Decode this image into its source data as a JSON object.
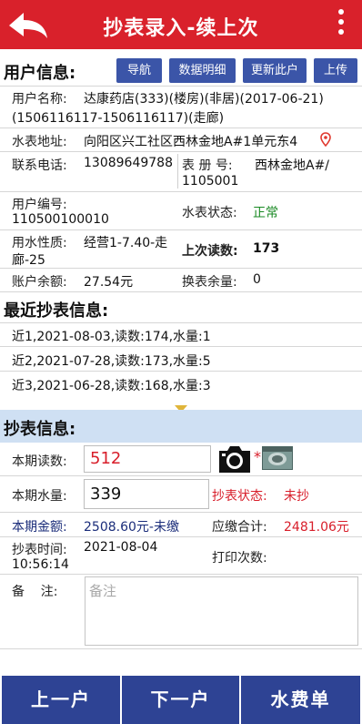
{
  "header": {
    "title": "抄表录入-续上次"
  },
  "user_section": {
    "title": "用户信息:",
    "buttons": [
      "导航",
      "数据明细",
      "更新此户",
      "上传"
    ]
  },
  "user_info": {
    "name_label": "用户名称:",
    "name_value": "达康药店(333)(楼房)(非居)(2017-06-21)",
    "name_value2": "(1506116117-1506116117)(走廊)",
    "meter_addr_label": "水表地址:",
    "meter_addr_value": "向阳区兴工社区西林金地A#1单元东4",
    "phone_label": "联系电话:",
    "phone_value": "13089649788",
    "register_label": "表  册  号:",
    "register_value": "西林金地A#/",
    "register_value2": "1105001",
    "user_no_label": "用户编号:",
    "user_no_value": "110500100010",
    "meter_status_label": "水表状态:",
    "meter_status_value": "正常",
    "water_type_label": "用水性质:",
    "water_type_value": "经营1-7.40-走",
    "water_type_value2": "廊-25",
    "last_reading_label": "上次读数:",
    "last_reading_value": "173",
    "balance_label": "账户余额:",
    "balance_value": "27.54元",
    "swap_remain_label": "换表余量:",
    "swap_remain_value": "0"
  },
  "recent_section": {
    "title": "最近抄表信息:",
    "items": [
      "近1,2021-08-03,读数:174,水量:1",
      "近2,2021-07-28,读数:173,水量:5",
      "近3,2021-06-28,读数:168,水量:3"
    ]
  },
  "reading_section": {
    "title": "抄表信息:",
    "current_reading_label": "本期读数:",
    "current_reading_value": "512",
    "current_volume_label": "本期水量:",
    "current_volume_value": "339",
    "reading_status_label": "抄表状态:",
    "reading_status_value": "未抄",
    "amount_label": "本期金额:",
    "amount_value": "2508.60元-未缴",
    "total_due_label": "应缴合计:",
    "total_due_value": "2481.06元",
    "read_time_label": "抄表时间:",
    "read_time_value": "2021-08-04",
    "read_time_value2": "10:56:14",
    "print_count_label": "打印次数:",
    "remark_label": "备    注:",
    "remark_placeholder": "备注",
    "required_mark": "*"
  },
  "bottom": {
    "prev": "上一户",
    "next": "下一户",
    "bill": "水费单"
  },
  "colors": {
    "header_red": "#d9212b",
    "button_blue": "#3b55a8",
    "bottom_blue": "#2e4394",
    "section_bg": "#cfe0f3",
    "status_green": "#1a8a24",
    "alert_red": "#d81e2a"
  }
}
